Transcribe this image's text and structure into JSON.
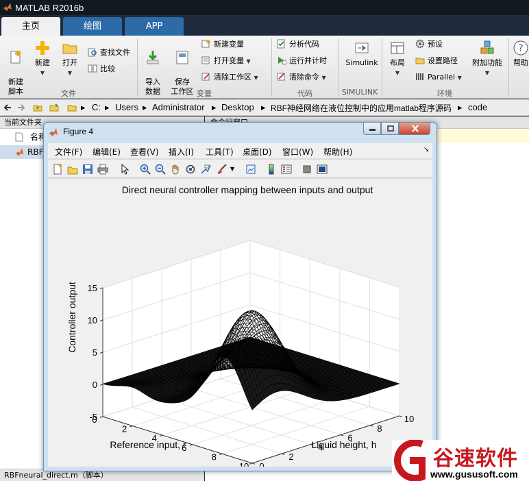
{
  "app": {
    "title": "MATLAB R2016b"
  },
  "tabs": [
    {
      "label": "主页",
      "active": true
    },
    {
      "label": "绘图",
      "active": false
    },
    {
      "label": "APP",
      "active": false
    }
  ],
  "ribbon": {
    "file": {
      "group_label": "文件",
      "new_script": "新建\n脚本",
      "new": "新建",
      "open": "打开",
      "find_files": "查找文件",
      "compare": "比较"
    },
    "variable": {
      "group_label": "变量",
      "import_data": "导入\n数据",
      "save_workspace": "保存\n工作区",
      "new_variable": "新建变量",
      "open_variable": "打开变量",
      "clear_workspace": "清除工作区"
    },
    "code": {
      "group_label": "代码",
      "analyze_code": "分析代码",
      "run_and_time": "运行并计时",
      "clear_commands": "清除命令"
    },
    "simulink": {
      "group_label": "SIMULINK",
      "simulink": "Simulink"
    },
    "environment": {
      "group_label": "环境",
      "layout": "布局",
      "preferences": "预设",
      "set_path": "设置路径",
      "parallel": "Parallel",
      "add_ons": "附加功能",
      "help": "帮助"
    }
  },
  "address_bar": {
    "path": [
      "C:",
      "Users",
      "Administrator",
      "Desktop",
      "RBF神经网络在液位控制中的应用matlab程序源码",
      "code"
    ]
  },
  "current_folder": {
    "title": "当前文件夹",
    "name_col": "名称",
    "selected_item": "RBF",
    "status": "RBFneural_direct.m（脚本）"
  },
  "command_window": {
    "title": "命令行窗口"
  },
  "figure": {
    "title": "Figure 4",
    "menu": [
      "文件(F)",
      "编辑(E)",
      "查看(V)",
      "插入(I)",
      "工具(T)",
      "桌面(D)",
      "窗口(W)",
      "帮助(H)"
    ]
  },
  "chart_data": {
    "type": "surface",
    "title": "Direct neural controller mapping between inputs and output",
    "xlabel": "Reference input, r",
    "ylabel": "Liquid height, h",
    "zlabel": "Controller output",
    "xlim": [
      0,
      10
    ],
    "ylim": [
      0,
      10
    ],
    "zlim": [
      -5,
      15
    ],
    "xticks": [
      0,
      2,
      4,
      6,
      8,
      10
    ],
    "yticks": [
      0,
      2,
      4,
      6,
      8,
      10
    ],
    "zticks": [
      -5,
      0,
      5,
      10,
      15
    ],
    "grid": true,
    "mesh": {
      "samples": [
        {
          "r": 0,
          "h": 0,
          "u": 0
        },
        {
          "r": 2,
          "h": 0,
          "u": 1
        },
        {
          "r": 10,
          "h": 0,
          "u": 0
        },
        {
          "r": 0,
          "h": 10,
          "u": 0
        },
        {
          "r": 6,
          "h": 3,
          "u": 5
        },
        {
          "r": 7,
          "h": 2,
          "u": 10
        },
        {
          "r": 8,
          "h": 1,
          "u": 14.5
        },
        {
          "r": 10,
          "h": 3,
          "u": 11
        },
        {
          "r": 10,
          "h": 10,
          "u": 0
        }
      ]
    }
  },
  "watermark": {
    "brand": "谷速软件",
    "url": "www.gususoft.com",
    "color": "#c8171e"
  }
}
